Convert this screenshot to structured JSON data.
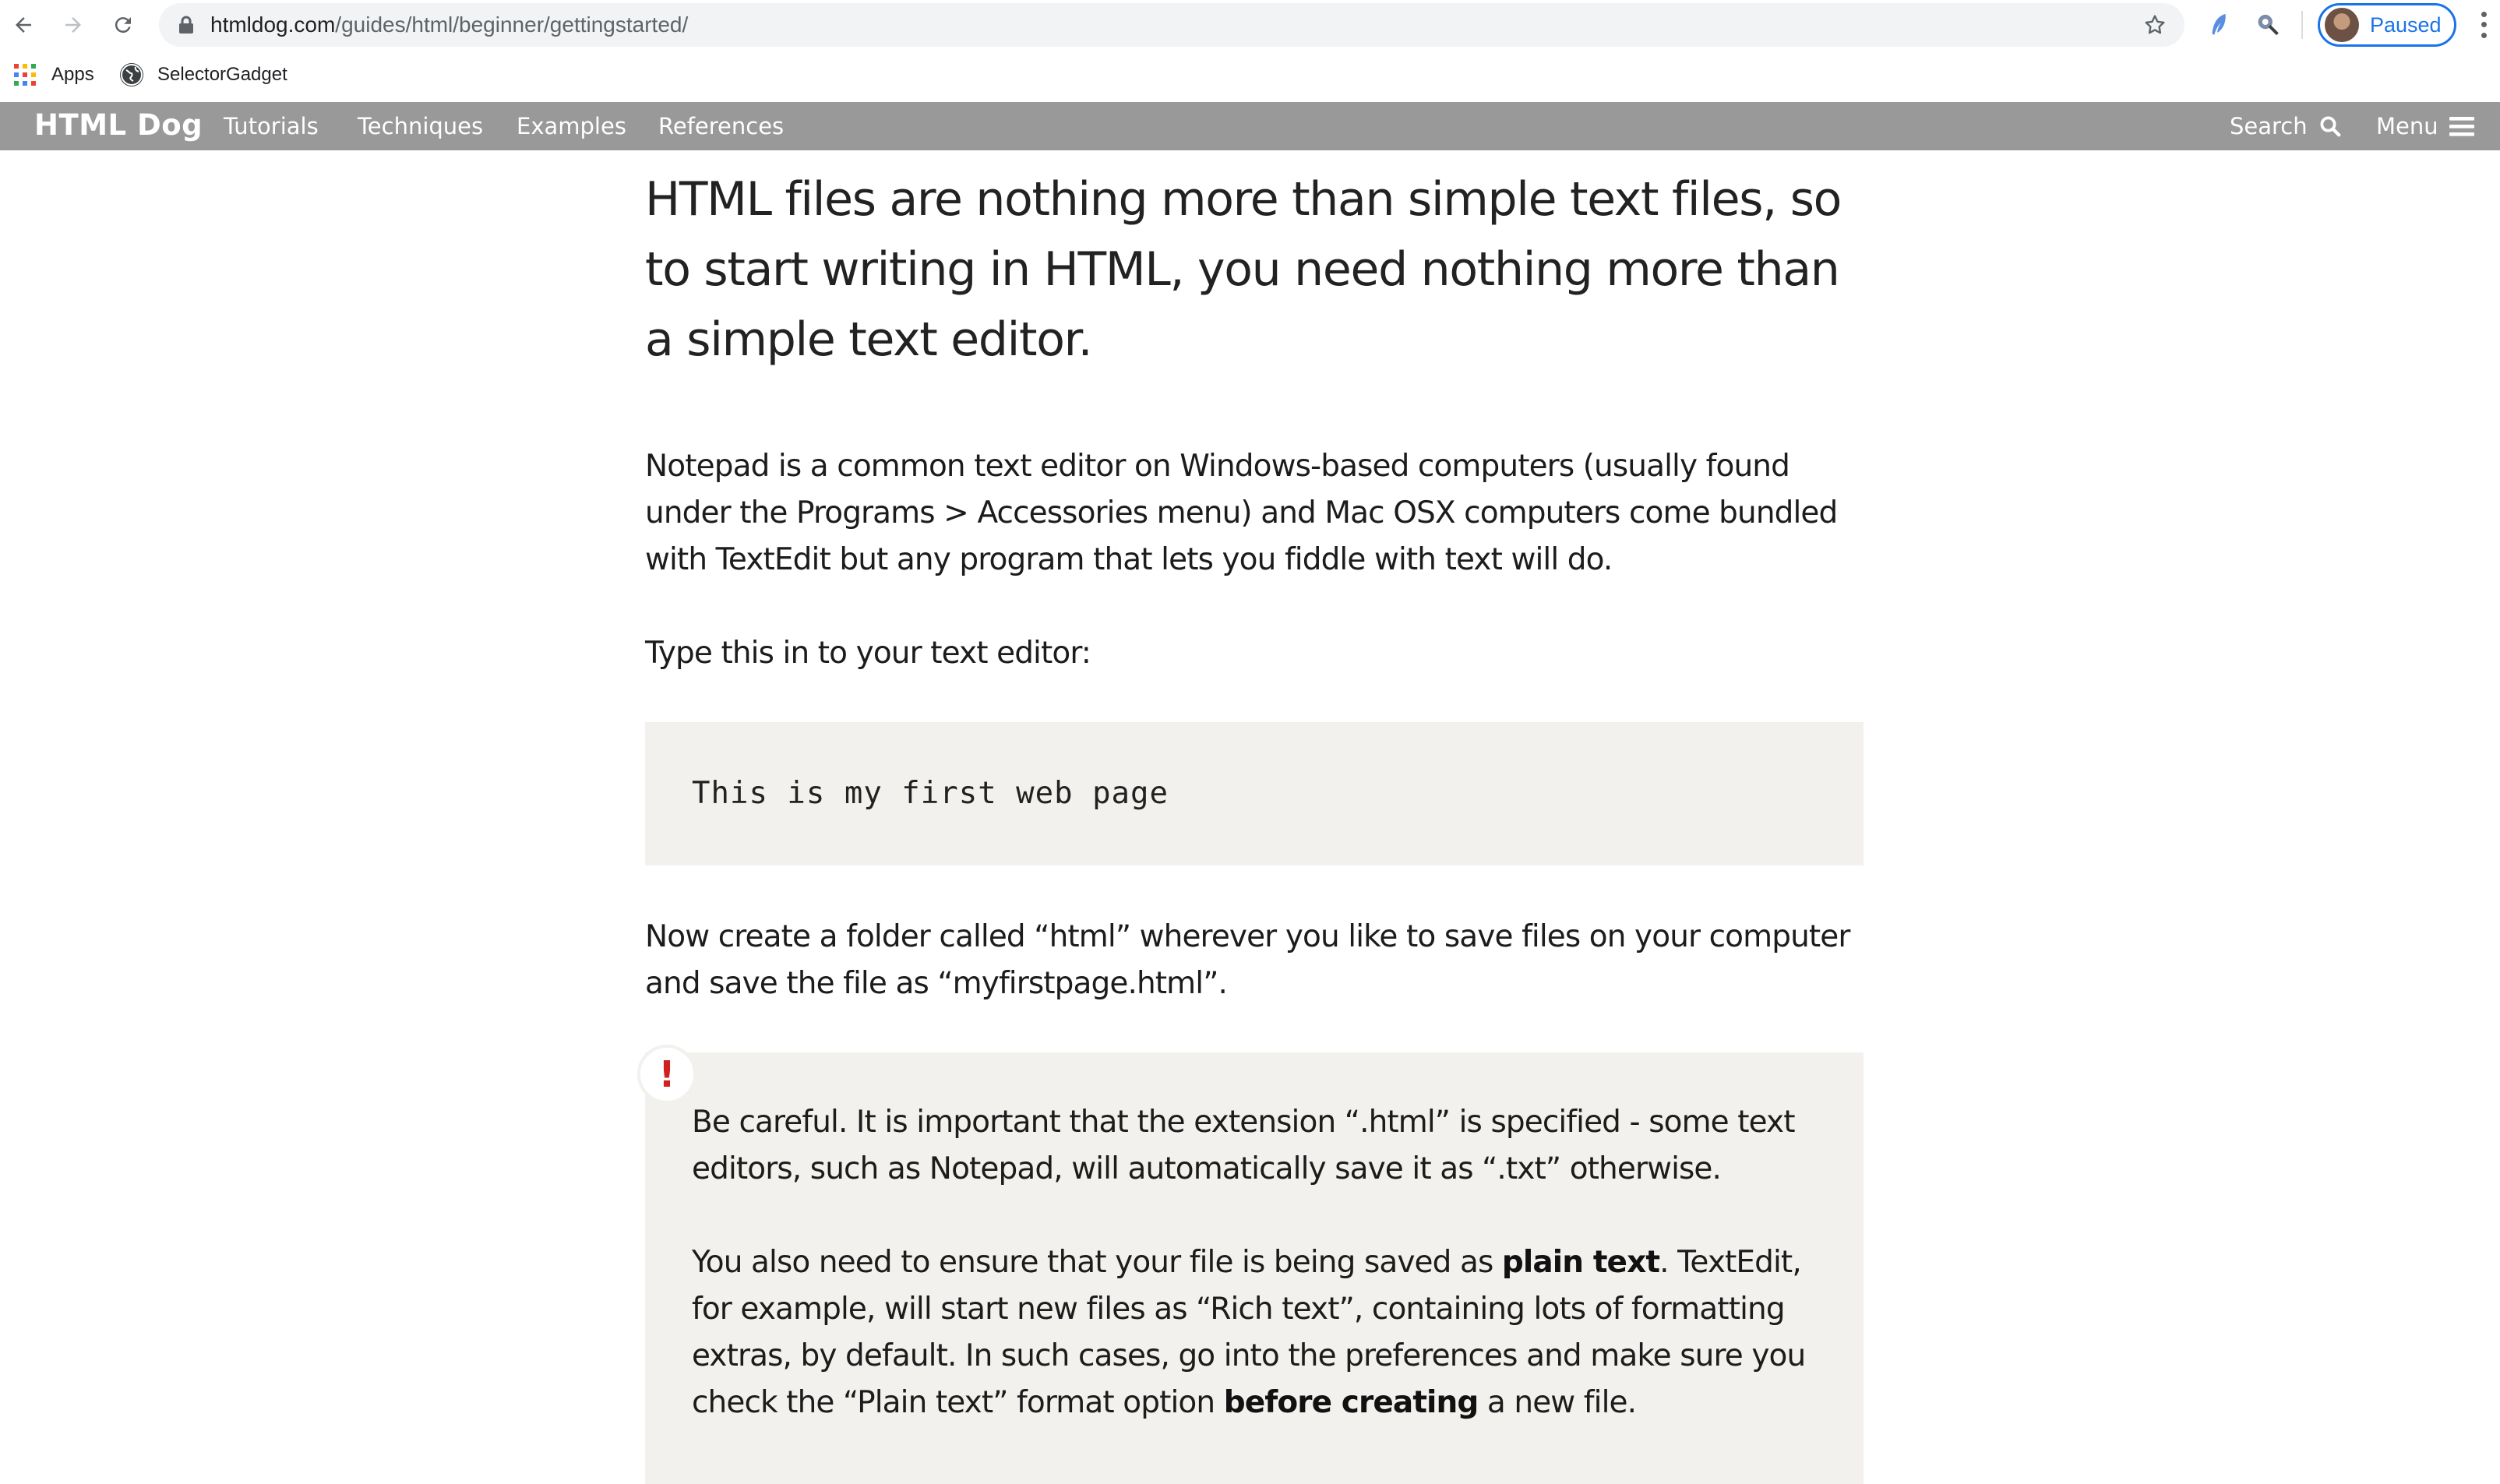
{
  "browser": {
    "url_host": "htmldog.com",
    "url_path": "/guides/html/beginner/gettingstarted/",
    "profile_label": "Paused"
  },
  "bookmarks": {
    "items": [
      {
        "label": "Apps",
        "icon": "apps-grid-icon"
      },
      {
        "label": "SelectorGadget",
        "icon": "globe-icon"
      }
    ]
  },
  "site": {
    "logo": "HTML Dog",
    "nav": [
      "Tutorials",
      "Techniques",
      "Examples",
      "References"
    ],
    "search_label": "Search",
    "menu_label": "Menu"
  },
  "article": {
    "lead": "HTML files are nothing more than simple text files, so to start writing in HTML, you need nothing more than a simple text editor.",
    "p1": "Notepad is a common text editor on Windows-based computers (usually found under the Programs > Accessories menu) and Mac OSX computers come bundled with TextEdit but any program that lets you fiddle with text will do.",
    "p2": "Type this in to your text editor:",
    "code": "This is my first web page",
    "p3": "Now create a folder called “html” wherever you like to save files on your computer and save the file as “myfirstpage.html”.",
    "note_badge": "!",
    "note_p1": "Be careful. It is important that the extension “.html” is specified - some text editors, such as Notepad, will automatically save it as “.txt” otherwise.",
    "note_p2_a": "You also need to ensure that your file is being saved as ",
    "note_p2_b": "plain text",
    "note_p2_c": ". TextEdit, for example, will start new files as “Rich text”, containing lots of formatting extras, by default. In such cases, go into the preferences and make sure you check the “Plain text” format option ",
    "note_p2_d": "before creating",
    "note_p2_e": " a new file."
  },
  "colors": {
    "site_header_bg": "#999999",
    "code_bg": "#f3f1ee",
    "note_icon": "#d21f1f",
    "profile_accent": "#1a73e8"
  }
}
